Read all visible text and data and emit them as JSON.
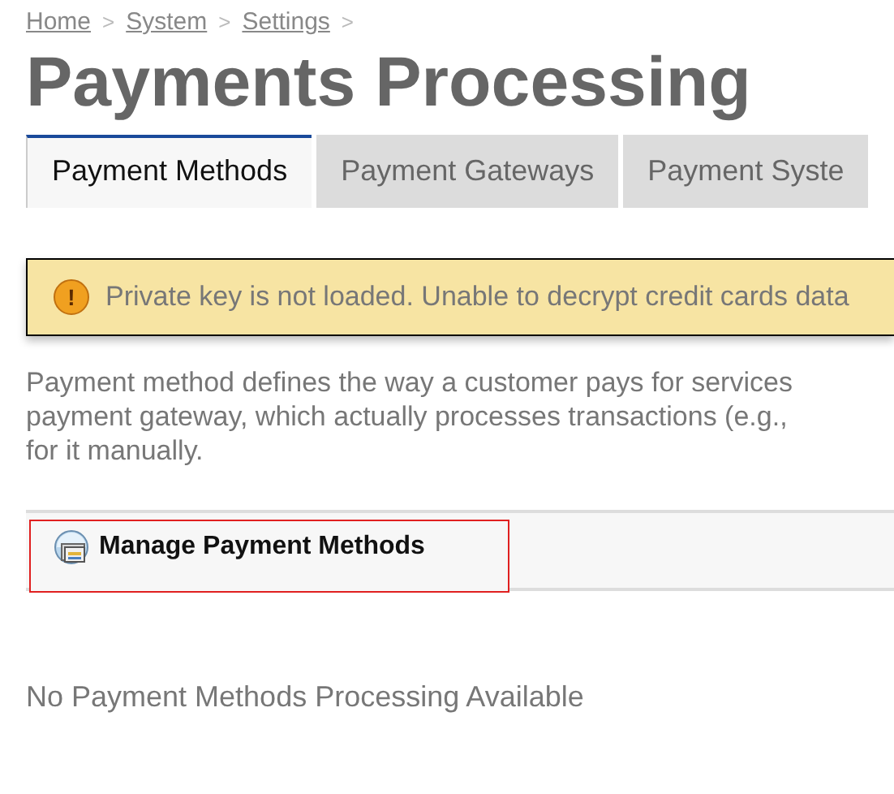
{
  "breadcrumb": [
    "Home",
    "System",
    "Settings"
  ],
  "separator": ">",
  "title": "Payments Processing",
  "tabs": [
    {
      "label": "Payment Methods",
      "selected": true
    },
    {
      "label": "Payment Gateways",
      "selected": false
    },
    {
      "label": "Payment Syste",
      "selected": false
    }
  ],
  "alert": {
    "icon": "!",
    "text": "Private key is not loaded. Unable to decrypt credit cards data"
  },
  "description": [
    "Payment method defines the way a customer pays for services",
    "payment gateway, which actually processes transactions (e.g.,",
    "for it manually."
  ],
  "toolbar": {
    "button": "Manage Payment Methods"
  },
  "empty_message": "No Payment Methods Processing Available"
}
